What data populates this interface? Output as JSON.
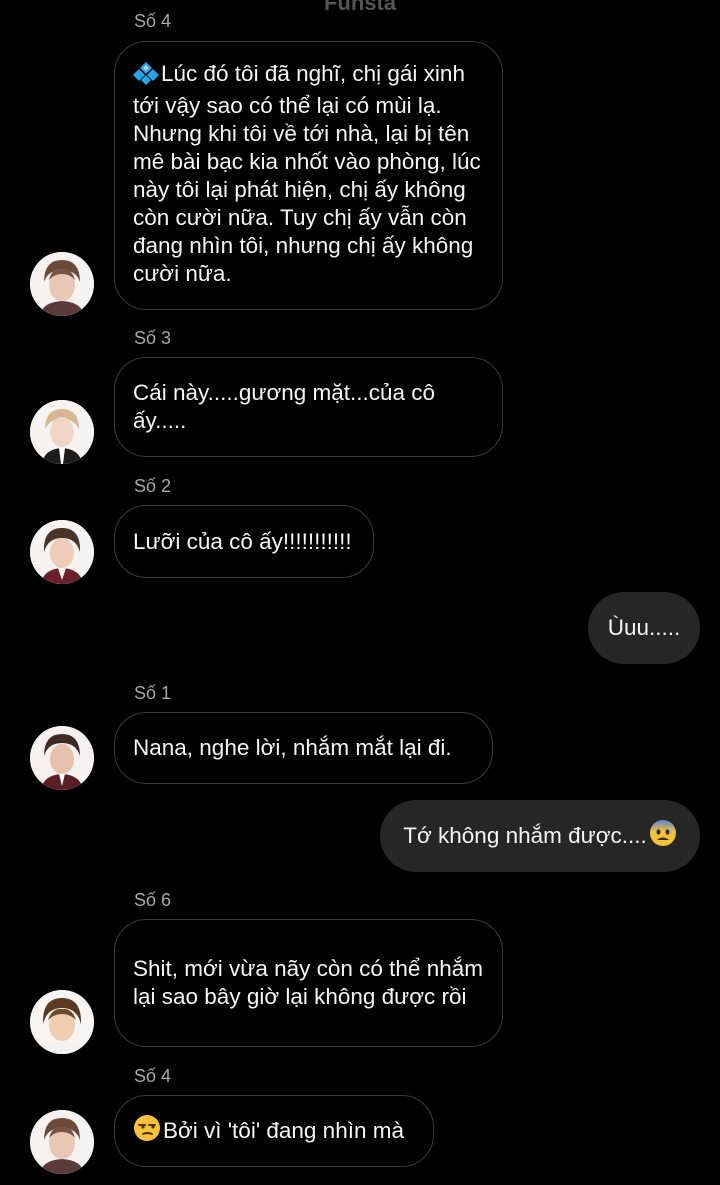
{
  "header": {
    "title": "Funsta"
  },
  "messages": [
    {
      "sender": "Số 4",
      "text": "Lúc đó tôi đã nghĩ, chị gái xinh tới vậy sao có thể lại có mùi lạ. Nhưng khi tôi về tới nhà, lại bị tên mê bài bạc kia nhốt vào phòng, lúc này tôi lại phát hiện, chị ấy không còn cười nữa. Tuy chị ấy vẫn còn đang nhìn tôi, nhưng chị ấy không cười nữa.",
      "lead_emoji": "diamond-emoji"
    },
    {
      "sender": "Số 3",
      "text": "Cái này.....gương mặt...của cô ấy....."
    },
    {
      "sender": "Số 2",
      "text": "Lưỡi của cô ấy!!!!!!!!!!!"
    },
    {
      "outgoing": true,
      "text": "Ùuu....."
    },
    {
      "sender": "Số 1",
      "text": "Nana, nghe lời, nhắm mắt lại đi."
    },
    {
      "outgoing": true,
      "text": "Tớ không nhắm được....",
      "trail_emoji": "anxious-face-emoji"
    },
    {
      "sender": "Số 6",
      "text": "Shit, mới vừa nãy còn có thể nhắm lại sao bây giờ lại không được rồi"
    },
    {
      "sender": "Số 4",
      "text": "Bởi vì 'tôi' đang nhìn mà",
      "lead_emoji": "unamused-face-emoji"
    }
  ],
  "colors": {
    "background": "#000000",
    "incoming_border": "#3a3a3a",
    "outgoing_fill": "#262626",
    "sender_label": "#a8a8a8",
    "text": "#f5f5f5"
  }
}
